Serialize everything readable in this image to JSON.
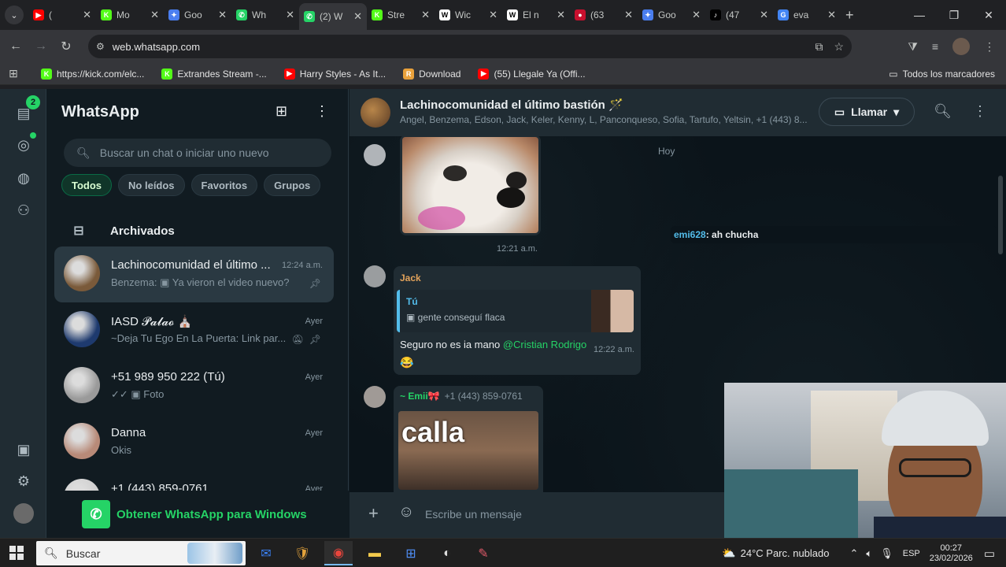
{
  "browser": {
    "tabs": [
      {
        "title": "(",
        "icon": "youtube-icon",
        "color": "#ff0000",
        "glyph": "▶",
        "active": false
      },
      {
        "title": "Mo",
        "icon": "kick-icon",
        "color": "#53fc18",
        "glyph": "K",
        "active": false
      },
      {
        "title": "Goo",
        "icon": "gemini-icon",
        "color": "#4a7ef0",
        "glyph": "✦",
        "active": false
      },
      {
        "title": "Wh",
        "icon": "whatsapp-icon",
        "color": "#25d366",
        "glyph": "✆",
        "active": false
      },
      {
        "title": "(2) W",
        "icon": "whatsapp-icon",
        "color": "#25d366",
        "glyph": "✆",
        "active": true
      },
      {
        "title": "Stre",
        "icon": "kick-icon",
        "color": "#53fc18",
        "glyph": "K",
        "active": false
      },
      {
        "title": "Wic",
        "icon": "wikipedia-icon",
        "color": "#ffffff",
        "glyph": "W",
        "active": false
      },
      {
        "title": "El n",
        "icon": "wikipedia-icon",
        "color": "#ffffff",
        "glyph": "W",
        "active": false
      },
      {
        "title": "(63",
        "icon": "news-icon",
        "color": "#c8102e",
        "glyph": "●",
        "active": false
      },
      {
        "title": "Goo",
        "icon": "gemini-icon",
        "color": "#4a7ef0",
        "glyph": "✦",
        "active": false
      },
      {
        "title": "(47",
        "icon": "tiktok-icon",
        "color": "#000000",
        "glyph": "♪",
        "active": false
      },
      {
        "title": "eva",
        "icon": "google-icon",
        "color": "#4285f4",
        "glyph": "G",
        "active": false
      }
    ],
    "url": "web.whatsapp.com",
    "bookmarks": [
      {
        "label": "https://kick.com/elc...",
        "color": "#53fc18",
        "glyph": "K"
      },
      {
        "label": "Extrandes Stream -...",
        "color": "#53fc18",
        "glyph": "K"
      },
      {
        "label": "Harry Styles - As It...",
        "color": "#ff0000",
        "glyph": "▶"
      },
      {
        "label": "Download",
        "color": "#e9a13b",
        "glyph": "R"
      },
      {
        "label": "(55) Llegale Ya (Offi...",
        "color": "#ff0000",
        "glyph": "▶"
      }
    ],
    "all_bookmarks": "Todos los marcadores"
  },
  "rail": {
    "chats_badge": "2"
  },
  "sidebar": {
    "title": "WhatsApp",
    "search_placeholder": "Buscar un chat o iniciar uno nuevo",
    "filters": [
      "Todos",
      "No leídos",
      "Favoritos",
      "Grupos"
    ],
    "archived_label": "Archivados",
    "chats": [
      {
        "name": "Lachinocomunidad el último ...",
        "time": "12:24 a.m.",
        "last": "Benzema: ▣ Ya vieron el video nuevo?",
        "pinned": true,
        "muted": false,
        "selected": true,
        "avatar": "#7a5a3a"
      },
      {
        "name": "IASD 𝓟𝓪𝓵𝓪𝓸 ⛪",
        "time": "Ayer",
        "last": "~Deja Tu Ego En La Puerta: Link par...",
        "pinned": true,
        "muted": true,
        "selected": false,
        "avatar": "#1e3a6e"
      },
      {
        "name": "+51 989 950 222 (Tú)",
        "time": "Ayer",
        "last": "✓✓ ▣ Foto",
        "pinned": false,
        "muted": false,
        "selected": false,
        "avatar": "#9a9a9a"
      },
      {
        "name": "Danna",
        "time": "Ayer",
        "last": "Okis",
        "pinned": false,
        "muted": false,
        "selected": false,
        "avatar": "#b88a78"
      },
      {
        "name": "+1 (443) 859-0761",
        "time": "Ayer",
        "last": "",
        "pinned": false,
        "muted": false,
        "selected": false,
        "avatar": "#cfcfcf"
      }
    ],
    "get_app": "Obtener WhatsApp para Windows"
  },
  "conversation": {
    "name": "Lachinocomunidad el último bastión 🪄",
    "members": "Angel, Benzema, Edson, Jack, Keler, Kenny, L, Panconqueso, Sofia, Tartufo, Yeltsin, +1 (443) 8...",
    "call_label": "Llamar",
    "day_label": "Hoy",
    "image_time": "12:21 a.m.",
    "system_user": "emi628",
    "system_text": ": ah chucha",
    "reply": {
      "sender": "Jack",
      "quoted_name": "Tú",
      "quoted_text": "▣ gente conseguí flaca",
      "text": "Seguro no es ia mano ",
      "mention": "@Cristian Rodrigo",
      "time": "12:22 a.m.",
      "reaction": "😂"
    },
    "next_sender": "~ Emii🎀",
    "next_phone": "+1 (443) 859-0761",
    "sticker_text": "calla",
    "composer_placeholder": "Escribe un mensaje"
  },
  "taskbar": {
    "search_placeholder": "Buscar",
    "weather": "24°C  Parc. nublado",
    "lang": "ESP",
    "time": "00:27",
    "date": "23/02/2026"
  },
  "colors": {
    "accent": "#25d366",
    "panel": "#111b21",
    "header": "#202c33"
  }
}
